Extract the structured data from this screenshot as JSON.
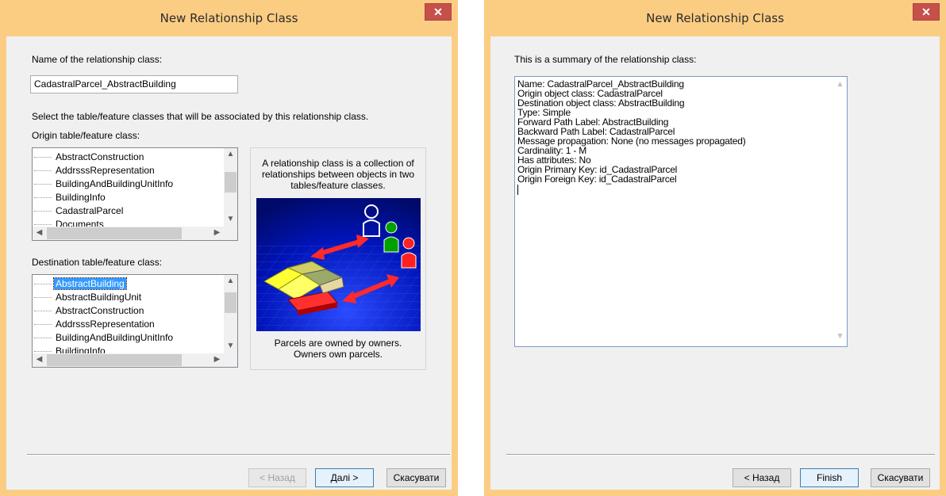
{
  "left_dialog": {
    "title": "New Relationship Class",
    "name_label": "Name of the relationship class:",
    "name_value": "CadastralParcel_AbstractBuilding",
    "select_label": "Select the table/feature classes that will be associated by this relationship class.",
    "origin_label": "Origin table/feature class:",
    "origin_items": [
      "AbstractConstruction",
      "AddrsssRepresentation",
      "BuildingAndBuildingUnitInfo",
      "BuildingInfo",
      "CadastralParcel",
      "Documents"
    ],
    "destination_label": "Destination table/feature class:",
    "destination_items": [
      "AbstractBuilding",
      "AbstractBuildingUnit",
      "AbstractConstruction",
      "AddrsssRepresentation",
      "BuildingAndBuildingUnitInfo",
      "BuildingInfo"
    ],
    "destination_selected": "AbstractBuilding",
    "info_top": [
      "A relationship class is a collection of",
      "relationships between objects in two",
      "tables/feature classes."
    ],
    "info_bottom": [
      "Parcels are owned by owners.",
      "Owners own parcels."
    ],
    "back_button": "< Назад",
    "next_button": "Далі >",
    "cancel_button": "Скасувати"
  },
  "right_dialog": {
    "title": "New Relationship Class",
    "summary_label": "This is a summary of the relationship class:",
    "summary_lines": [
      "Name: CadastralParcel_AbstractBuilding",
      "Origin object class: CadastralParcel",
      "Destination object class: AbstractBuilding",
      "Type: Simple",
      "Forward Path Label: AbstractBuilding",
      "Backward Path Label: CadastralParcel",
      "Message propagation: None (no messages propagated)",
      "Cardinality: 1 - M",
      "Has attributes: No",
      "Origin Primary Key: id_CadastralParcel",
      "Origin Foreign Key: id_CadastralParcel"
    ],
    "back_button": "< Назад",
    "finish_button": "Finish",
    "cancel_button": "Скасувати"
  },
  "colors": {
    "title_bar": "#fbcd83",
    "close_button": "#c7504a",
    "selection": "#3399ff"
  },
  "icons": {
    "close": "close-icon",
    "scroll_up": "scroll-up-icon",
    "scroll_down": "scroll-down-icon",
    "scroll_left": "scroll-left-icon",
    "scroll_right": "scroll-right-icon"
  }
}
